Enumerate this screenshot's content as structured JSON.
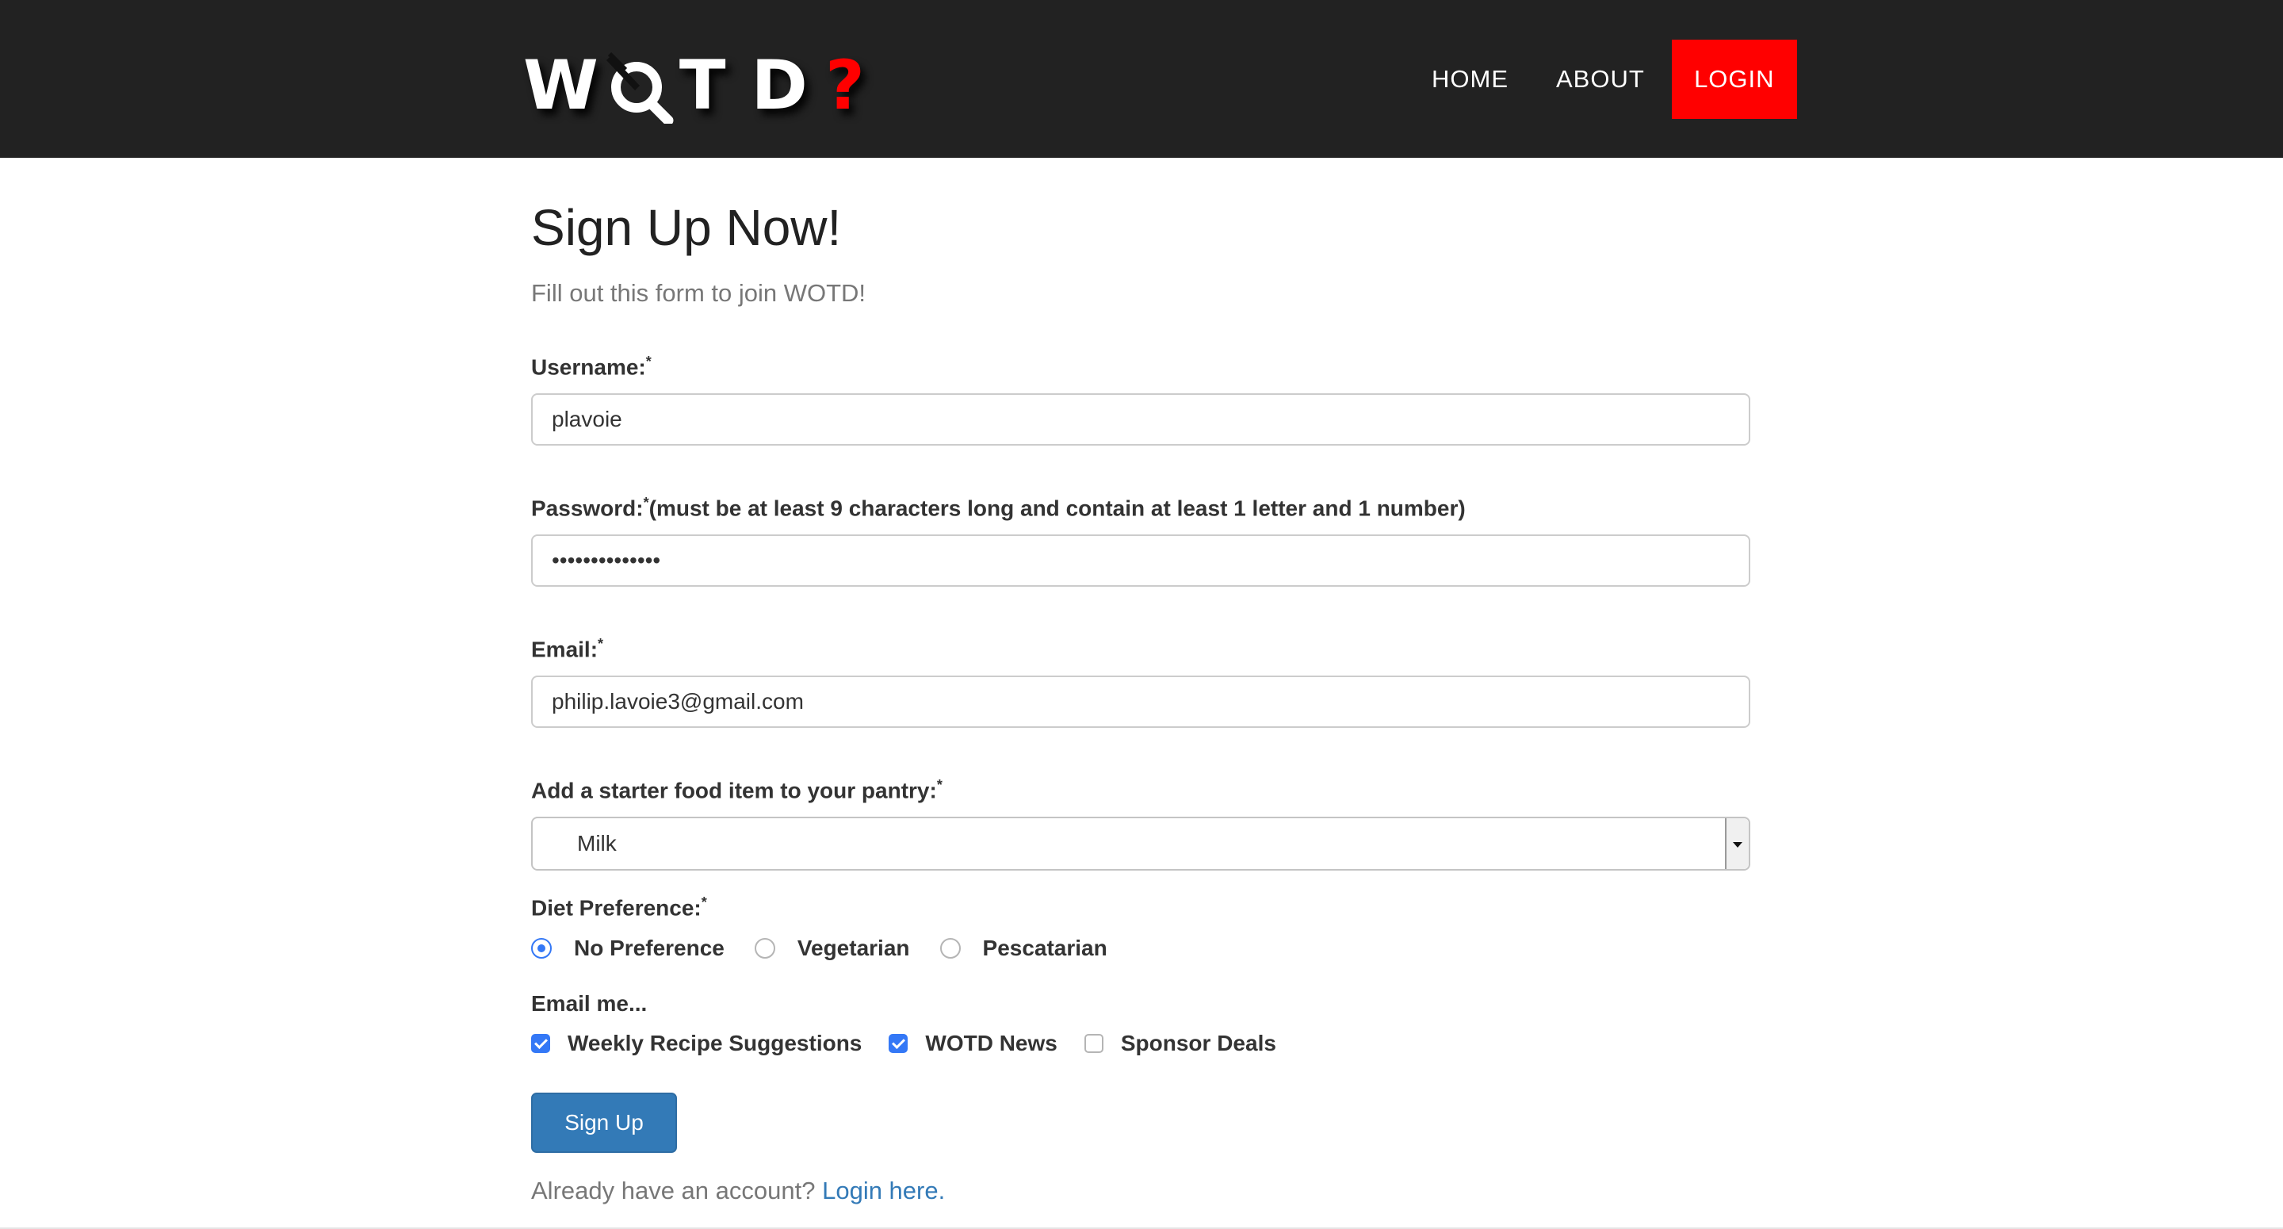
{
  "nav": {
    "logo": {
      "letters": [
        "W",
        "T",
        "D"
      ],
      "question": "?",
      "alt": "WOTD?"
    },
    "links": [
      {
        "label": "HOME"
      },
      {
        "label": "ABOUT"
      },
      {
        "label": "LOGIN",
        "active": true
      }
    ],
    "login_color": "#ff0000"
  },
  "form": {
    "title": "Sign Up Now!",
    "subtitle": "Fill out this form to join WOTD!",
    "required_marker": "*",
    "username": {
      "label": "Username:",
      "value": "plavoie"
    },
    "password": {
      "label": "Password:",
      "hint": "(must be at least 9 characters long and contain at least 1 letter and 1 number)",
      "value": "••••••••••••••"
    },
    "email": {
      "label": "Email:",
      "value": "philip.lavoie3@gmail.com"
    },
    "pantry": {
      "label": "Add a starter food item to your pantry:",
      "selected": "Milk"
    },
    "diet": {
      "label": "Diet Preference:",
      "options": [
        {
          "label": "No Preference",
          "checked": true
        },
        {
          "label": "Vegetarian",
          "checked": false
        },
        {
          "label": "Pescatarian",
          "checked": false
        }
      ]
    },
    "emailme": {
      "label": "Email me...",
      "options": [
        {
          "label": "Weekly Recipe Suggestions",
          "checked": true
        },
        {
          "label": "WOTD News",
          "checked": true
        },
        {
          "label": "Sponsor Deals",
          "checked": false
        }
      ]
    },
    "submit_label": "Sign Up",
    "footer": {
      "text": "Already have an account? ",
      "link": "Login here."
    }
  },
  "colors": {
    "navbar_bg": "#222222",
    "primary_button": "#337ab7",
    "link": "#337ab7",
    "radio_check_accent": "#3478f6"
  }
}
